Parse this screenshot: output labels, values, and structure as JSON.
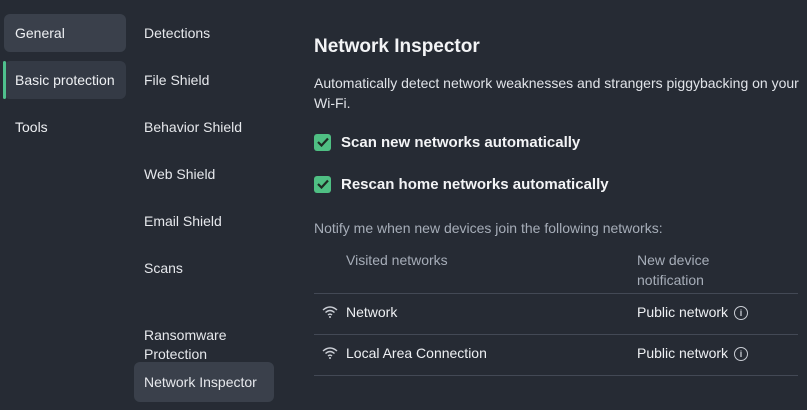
{
  "left_nav": {
    "items": [
      {
        "label": "General"
      },
      {
        "label": "Basic protection"
      },
      {
        "label": "Tools"
      }
    ]
  },
  "sub_nav": {
    "items": [
      {
        "label": "Detections"
      },
      {
        "label": "File Shield"
      },
      {
        "label": "Behavior Shield"
      },
      {
        "label": "Web Shield"
      },
      {
        "label": "Email Shield"
      },
      {
        "label": "Scans"
      },
      {
        "label": "Ransomware\nProtection"
      },
      {
        "label": "Network Inspector"
      }
    ]
  },
  "main": {
    "title": "Network Inspector",
    "description": "Automatically detect network weaknesses and strangers piggybacking on your Wi-Fi.",
    "options": [
      {
        "label": "Scan new networks automatically",
        "checked": true
      },
      {
        "label": "Rescan home networks automatically",
        "checked": true
      }
    ],
    "notify_label": "Notify me when new devices join the following networks:",
    "table": {
      "columns": [
        "Visited networks",
        "New device notification"
      ],
      "rows": [
        {
          "name": "Network",
          "type": "Public network"
        },
        {
          "name": "Local Area Connection",
          "type": "Public network"
        }
      ]
    }
  },
  "colors": {
    "background": "#262b34",
    "accent_green": "#4fbf83"
  }
}
